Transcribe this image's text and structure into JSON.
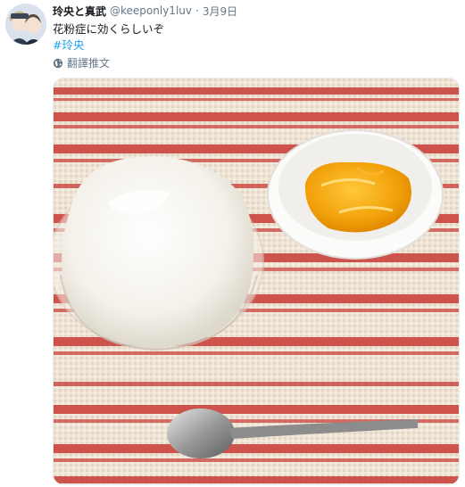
{
  "user": {
    "display_name": "玲央と真武",
    "handle": "@keeponly1luv",
    "separator": "·",
    "date": "3月9日"
  },
  "tweet": {
    "text": "花粉症に効くらしいぞ",
    "hashtag": "#玲央",
    "translate_label": "翻譯推文"
  },
  "icons": {
    "avatar": "avatar-illustration",
    "translate": "globe-icon"
  },
  "colors": {
    "link": "#1da1f2",
    "muted": "#657786",
    "text": "#14171a"
  }
}
